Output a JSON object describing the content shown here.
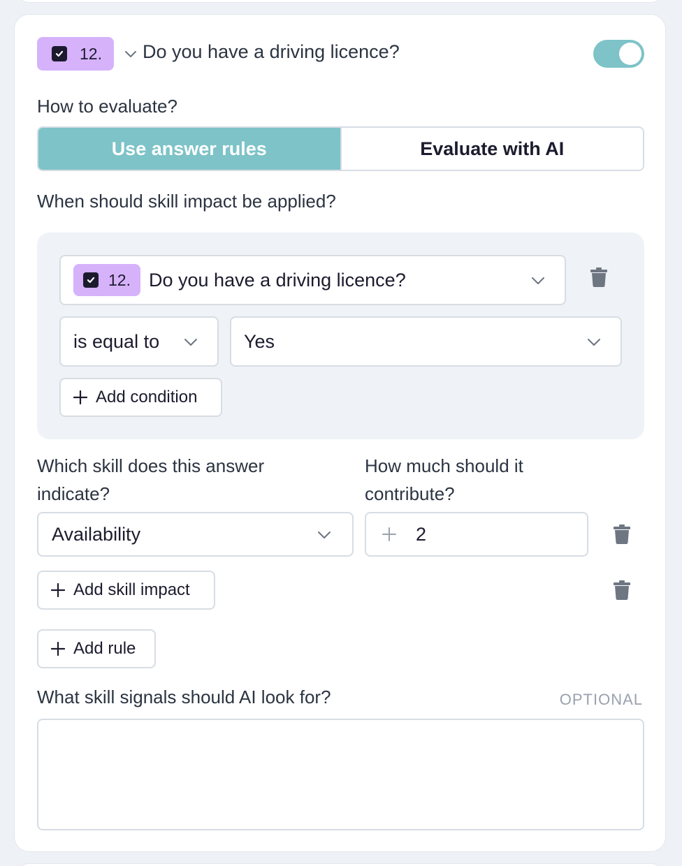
{
  "question": {
    "number": "12.",
    "title": "Do you have a driving licence?",
    "enabled": true
  },
  "evaluate": {
    "label": "How to evaluate?",
    "options": [
      "Use answer rules",
      "Evaluate with AI"
    ],
    "selected": "Use answer rules"
  },
  "rules": {
    "label": "When should skill impact be applied?",
    "condition": {
      "question_number": "12.",
      "question_title": "Do you have a driving licence?",
      "operator": "is equal to",
      "value": "Yes"
    },
    "add_condition_label": "Add condition"
  },
  "skill": {
    "skill_label": "Which skill does this answer indicate?",
    "contribution_label": "How much should it contribute?",
    "selected_skill": "Availability",
    "contribution_value": "2",
    "add_skill_label": "Add skill impact"
  },
  "add_rule_label": "Add rule",
  "ai_signals": {
    "label": "What skill signals should AI look for?",
    "optional": "OPTIONAL",
    "value": ""
  },
  "colors": {
    "accent": "#7dc3c8",
    "badge": "#d6b2fb",
    "border": "#d7dde4",
    "panel": "#eff2f6"
  },
  "icons": [
    "checkbox-icon",
    "chevron-down-icon",
    "trash-icon",
    "plus-icon"
  ]
}
